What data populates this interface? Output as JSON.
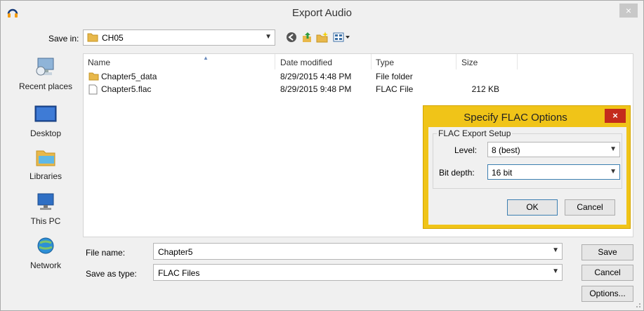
{
  "window": {
    "title": "Export Audio",
    "close_label": "×"
  },
  "save_in": {
    "label": "Save in:",
    "value": "CH05"
  },
  "toolbar": {
    "icons": [
      "back-icon",
      "up-folder-icon",
      "new-folder-icon",
      "view-menu-icon"
    ]
  },
  "places": [
    {
      "label": "Recent places",
      "icon": "recent-places-icon"
    },
    {
      "label": "Desktop",
      "icon": "desktop-icon"
    },
    {
      "label": "Libraries",
      "icon": "libraries-icon"
    },
    {
      "label": "This PC",
      "icon": "this-pc-icon"
    },
    {
      "label": "Network",
      "icon": "network-icon"
    }
  ],
  "file_list": {
    "columns": [
      "Name",
      "Date modified",
      "Type",
      "Size"
    ],
    "rows": [
      {
        "name": "Chapter5_data",
        "date": "8/29/2015 4:48 PM",
        "type": "File folder",
        "size": "",
        "icon": "folder-icon"
      },
      {
        "name": "Chapter5.flac",
        "date": "8/29/2015 9:48 PM",
        "type": "FLAC File",
        "size": "212 KB",
        "icon": "file-icon"
      }
    ]
  },
  "file_name": {
    "label": "File name:",
    "value": "Chapter5"
  },
  "save_as_type": {
    "label": "Save as type:",
    "value": "FLAC Files"
  },
  "buttons": {
    "save": "Save",
    "cancel": "Cancel",
    "options": "Options..."
  },
  "flac_dialog": {
    "title": "Specify FLAC Options",
    "close_label": "×",
    "group_title": "FLAC Export Setup",
    "level_label": "Level:",
    "level_value": "8 (best)",
    "bitdepth_label": "Bit depth:",
    "bitdepth_value": "16 bit",
    "ok": "OK",
    "cancel": "Cancel",
    "accent_color": "#f0c418"
  }
}
